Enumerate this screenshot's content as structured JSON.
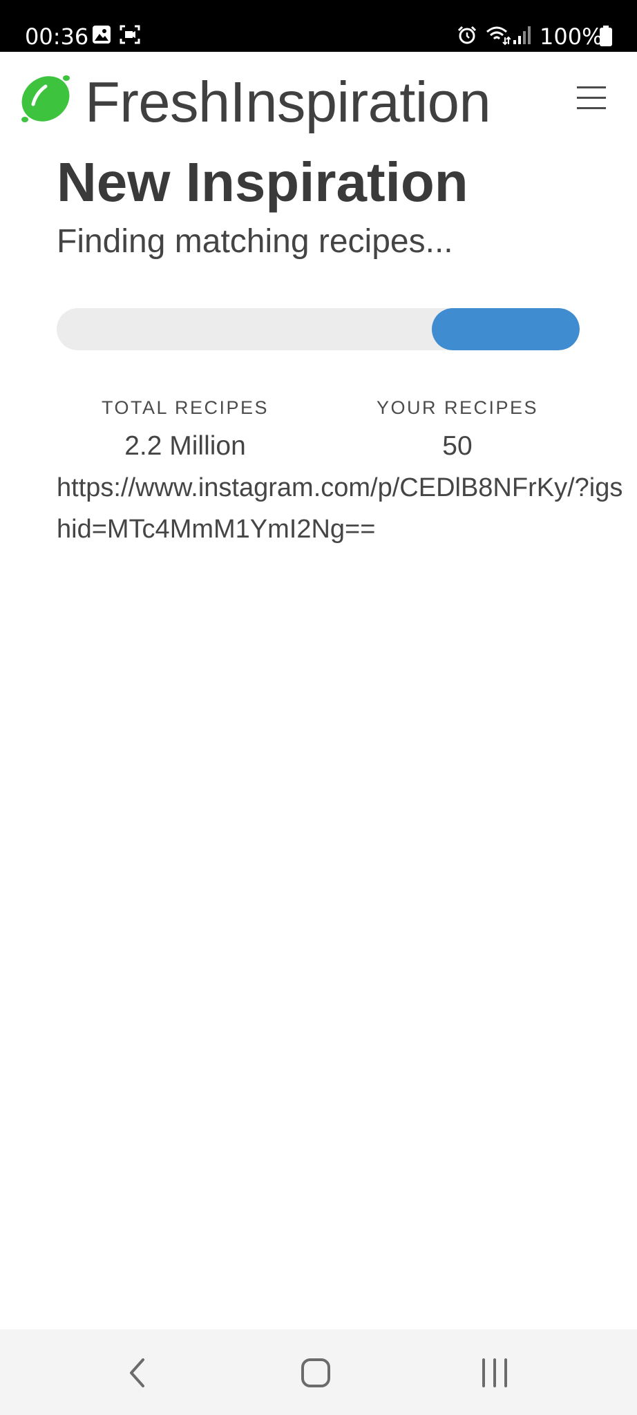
{
  "status_bar": {
    "time": "00:36",
    "battery": "100%",
    "icons": [
      "image-icon",
      "screen-record-icon",
      "alarm-icon",
      "wifi-icon",
      "signal-icon",
      "battery-icon"
    ]
  },
  "header": {
    "brand": "FreshInspiration",
    "logo_icon": "lime-icon",
    "logo_color": "#3ec33e",
    "menu_icon": "hamburger-menu-icon"
  },
  "main": {
    "title": "New Inspiration",
    "status": "Finding matching recipes...",
    "progress_color": "#3f8cd0",
    "progress": {
      "start_fraction": 0.717,
      "end_fraction": 1.0
    },
    "stats": [
      {
        "label": "TOTAL RECIPES",
        "value": "2.2 Million"
      },
      {
        "label": "YOUR RECIPES",
        "value": "50"
      }
    ],
    "shared_url": "https://www.instagram.com/p/CEDlB8NFrKy/?igshid=MTc4MmM1YmI2Ng=="
  },
  "nav_bar": {
    "buttons": [
      "back-icon",
      "home-icon",
      "recent-apps-icon"
    ]
  }
}
